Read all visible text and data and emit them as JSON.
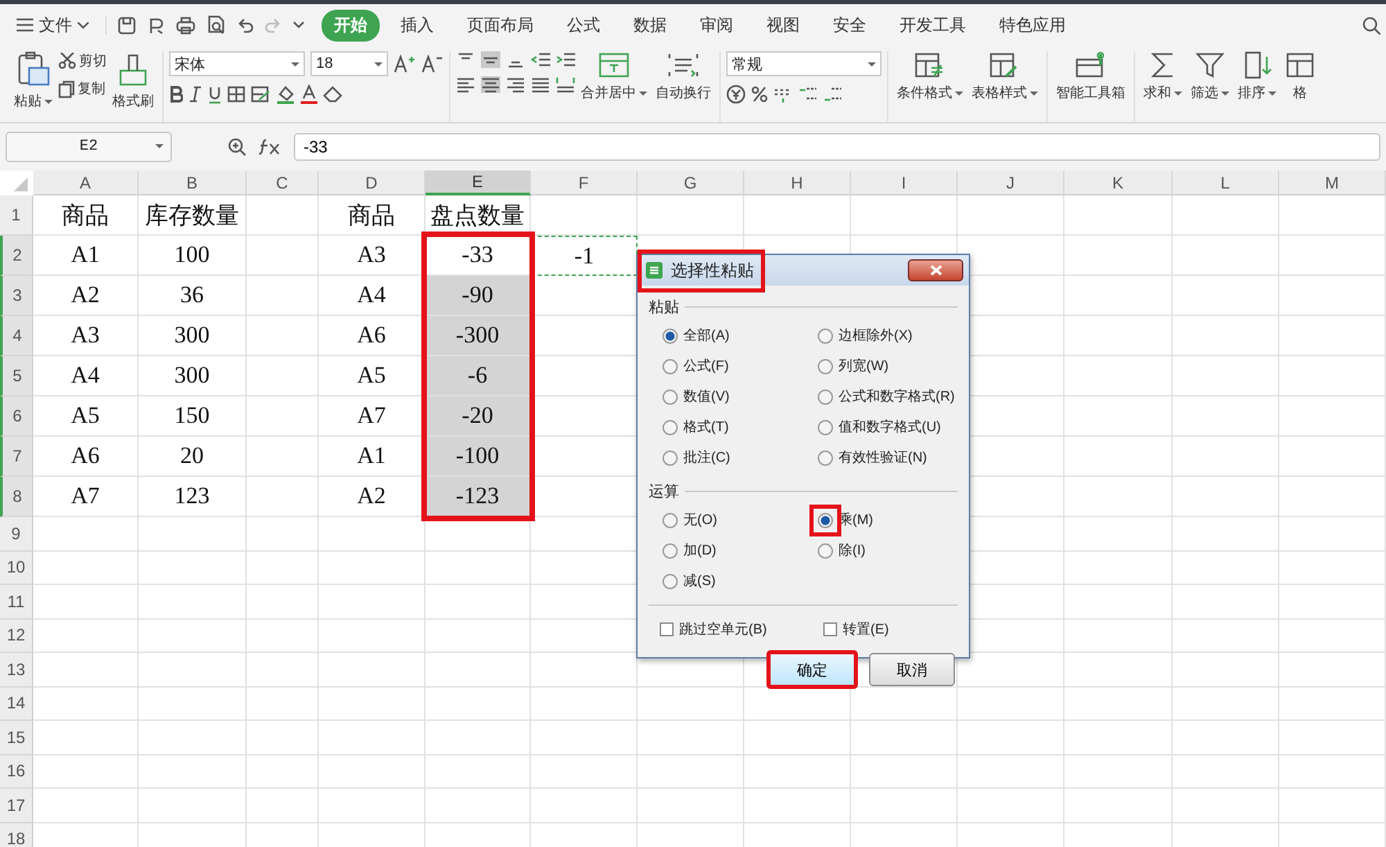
{
  "menu": {
    "file": "文件",
    "tabs": [
      {
        "label": "开始",
        "selected": true
      },
      {
        "label": "插入",
        "selected": false
      },
      {
        "label": "页面布局",
        "selected": false
      },
      {
        "label": "公式",
        "selected": false
      },
      {
        "label": "数据",
        "selected": false
      },
      {
        "label": "审阅",
        "selected": false
      },
      {
        "label": "视图",
        "selected": false
      },
      {
        "label": "安全",
        "selected": false
      },
      {
        "label": "开发工具",
        "selected": false
      },
      {
        "label": "特色应用",
        "selected": false
      }
    ]
  },
  "ribbon": {
    "paste": "粘贴",
    "cut": "剪切",
    "copy": "复制",
    "format_painter": "格式刷",
    "font_name": "宋体",
    "font_size": "18",
    "merge": "合并居中",
    "wrap": "自动换行",
    "number_format": "常规",
    "conditional_format": "条件格式",
    "table_style": "表格样式",
    "toolbox": "智能工具箱",
    "sum": "求和",
    "filter": "筛选",
    "sort": "排序",
    "format": "格"
  },
  "formula_bar": {
    "cell_name": "E2",
    "formula": "-33"
  },
  "sheet": {
    "columns": [
      {
        "label": "A",
        "selected": false
      },
      {
        "label": "B",
        "selected": false
      },
      {
        "label": "C",
        "selected": false
      },
      {
        "label": "D",
        "selected": false
      },
      {
        "label": "E",
        "selected": true,
        "boxed": true
      },
      {
        "label": "F",
        "selected": false
      },
      {
        "label": "G",
        "selected": false
      },
      {
        "label": "H",
        "selected": false
      },
      {
        "label": "I",
        "selected": false
      },
      {
        "label": "J",
        "selected": false
      },
      {
        "label": "K",
        "selected": false
      },
      {
        "label": "L",
        "selected": false
      },
      {
        "label": "M",
        "selected": false
      }
    ],
    "rows": [
      {
        "label": "1",
        "selected": false,
        "cells": [
          {
            "text": "商品"
          },
          {
            "text": "库存数量"
          },
          {
            "text": ""
          },
          {
            "text": "商品"
          },
          {
            "text": "盘点数量"
          }
        ]
      },
      {
        "label": "2",
        "selected": true,
        "cells": [
          {
            "text": "A1"
          },
          {
            "text": "100"
          },
          {
            "text": ""
          },
          {
            "text": "A3"
          },
          {
            "text": "-33",
            "selected": false
          },
          {
            "text": "-1",
            "copied": true
          }
        ]
      },
      {
        "label": "3",
        "selected": true,
        "cells": [
          {
            "text": "A2"
          },
          {
            "text": "36"
          },
          {
            "text": ""
          },
          {
            "text": "A4"
          },
          {
            "text": "-90",
            "selected": true
          }
        ]
      },
      {
        "label": "4",
        "selected": true,
        "cells": [
          {
            "text": "A3"
          },
          {
            "text": "300"
          },
          {
            "text": ""
          },
          {
            "text": "A6"
          },
          {
            "text": "-300",
            "selected": true
          }
        ]
      },
      {
        "label": "5",
        "selected": true,
        "cells": [
          {
            "text": "A4"
          },
          {
            "text": "300"
          },
          {
            "text": ""
          },
          {
            "text": "A5"
          },
          {
            "text": "-6",
            "selected": true
          }
        ]
      },
      {
        "label": "6",
        "selected": true,
        "cells": [
          {
            "text": "A5"
          },
          {
            "text": "150"
          },
          {
            "text": ""
          },
          {
            "text": "A7"
          },
          {
            "text": "-20",
            "selected": true
          }
        ]
      },
      {
        "label": "7",
        "selected": true,
        "cells": [
          {
            "text": "A6"
          },
          {
            "text": "20"
          },
          {
            "text": ""
          },
          {
            "text": "A1"
          },
          {
            "text": "-100",
            "selected": true
          }
        ]
      },
      {
        "label": "8",
        "selected": true,
        "cells": [
          {
            "text": "A7"
          },
          {
            "text": "123"
          },
          {
            "text": ""
          },
          {
            "text": "A2"
          },
          {
            "text": "-123",
            "selected": true
          }
        ]
      },
      {
        "label": "9",
        "selected": false,
        "cells": []
      },
      {
        "label": "10",
        "selected": false,
        "cells": []
      },
      {
        "label": "11",
        "selected": false,
        "cells": []
      },
      {
        "label": "12",
        "selected": false,
        "cells": []
      },
      {
        "label": "13",
        "selected": false,
        "cells": []
      },
      {
        "label": "14",
        "selected": false,
        "cells": []
      },
      {
        "label": "15",
        "selected": false,
        "cells": []
      },
      {
        "label": "16",
        "selected": false,
        "cells": []
      },
      {
        "label": "17",
        "selected": false,
        "cells": []
      },
      {
        "label": "18",
        "selected": false,
        "cells": []
      }
    ]
  },
  "dialog": {
    "title": "选择性粘贴",
    "title_highlighted": true,
    "paste_group": "粘贴",
    "paste_options": [
      {
        "label": "全部(A)",
        "selected": true
      },
      {
        "label": "边框除外(X)",
        "selected": false
      },
      {
        "label": "公式(F)",
        "selected": false
      },
      {
        "label": "列宽(W)",
        "selected": false
      },
      {
        "label": "数值(V)",
        "selected": false
      },
      {
        "label": "公式和数字格式(R)",
        "selected": false
      },
      {
        "label": "格式(T)",
        "selected": false
      },
      {
        "label": "值和数字格式(U)",
        "selected": false
      },
      {
        "label": "批注(C)",
        "selected": false
      },
      {
        "label": "有效性验证(N)",
        "selected": false
      }
    ],
    "operation_group": "运算",
    "operation_options": [
      {
        "label": "无(O)",
        "selected": false,
        "highlighted": false
      },
      {
        "label": "乘(M)",
        "selected": true,
        "highlighted": true
      },
      {
        "label": "加(D)",
        "selected": false,
        "highlighted": false
      },
      {
        "label": "除(I)",
        "selected": false,
        "highlighted": false
      },
      {
        "label": "减(S)",
        "selected": false,
        "highlighted": false
      }
    ],
    "checkboxes": [
      {
        "label": "跳过空单元(B)",
        "checked": false
      },
      {
        "label": "转置(E)",
        "checked": false
      }
    ],
    "buttons": [
      {
        "label": "确定",
        "kind": "default",
        "highlighted": true
      },
      {
        "label": "取消",
        "kind": "normal",
        "highlighted": false
      }
    ]
  }
}
